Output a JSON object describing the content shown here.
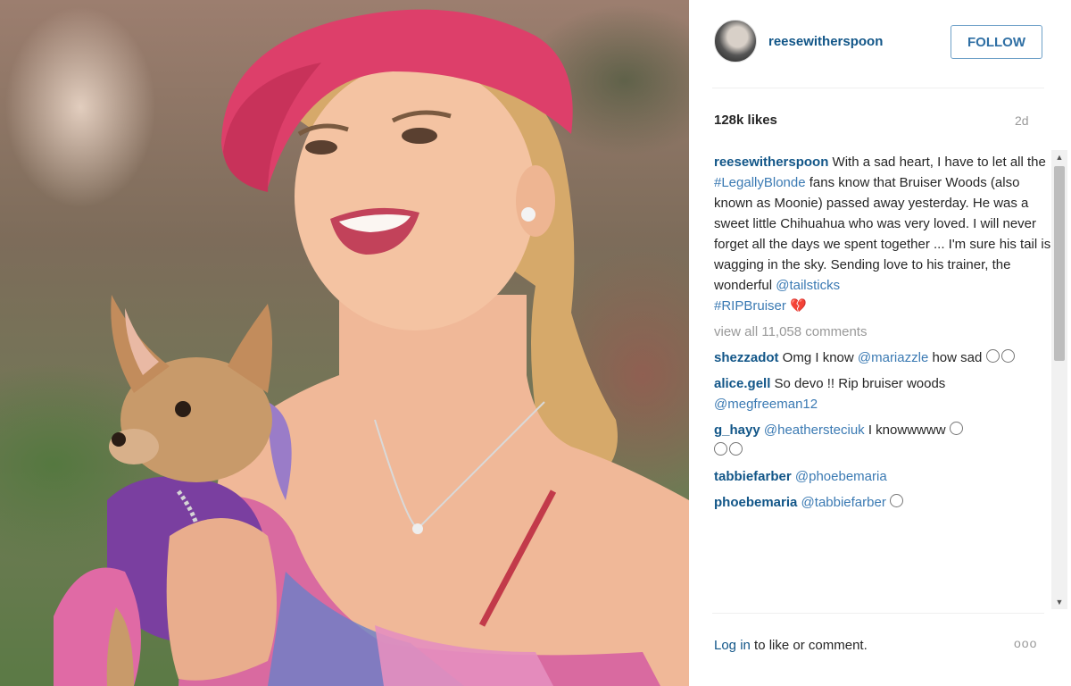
{
  "post": {
    "username": "reesewitherspoon",
    "follow_label": "FOLLOW",
    "likes": "128k likes",
    "age": "2d",
    "caption_user": "reesewitherspoon",
    "caption_part1": " With a sad heart, I have to let all the ",
    "caption_tag1": "#LegallyBlonde",
    "caption_part2": " fans know that Bruiser Woods (also known as Moonie) passed away yesterday. He was a sweet little Chihuahua who was very loved. I will never forget all the days we spent together ... I'm sure his tail is wagging in the sky. Sending love to his trainer, the wonderful ",
    "caption_tag2": "@tailsticks",
    "caption_tag3": "#RIPBruiser",
    "caption_heart": "💔",
    "view_all": "view all 11,058 comments"
  },
  "comments": [
    {
      "user": "shezzadot",
      "text1": " Omg I know ",
      "mention": "@mariazzle",
      "text2": " how sad"
    },
    {
      "user": "alice.gell",
      "text1": " So devo !! Rip bruiser woods ",
      "mention": "@megfreeman12",
      "text2": ""
    },
    {
      "user": "g_hayy",
      "text1": " ",
      "mention": "@heathersteciuk",
      "text2": " I knowwwww"
    },
    {
      "user": "tabbiefarber",
      "text1": " ",
      "mention": "@phoebemaria",
      "text2": ""
    },
    {
      "user": "phoebemaria",
      "text1": " ",
      "mention": "@tabbiefarber",
      "text2": ""
    }
  ],
  "footer": {
    "login_link": "Log in",
    "login_rest": " to like or comment.",
    "more": "ooo"
  },
  "icons": {
    "heart": "broken-heart-icon",
    "emoji": "emoji-face-icon",
    "more": "more-options-icon"
  }
}
